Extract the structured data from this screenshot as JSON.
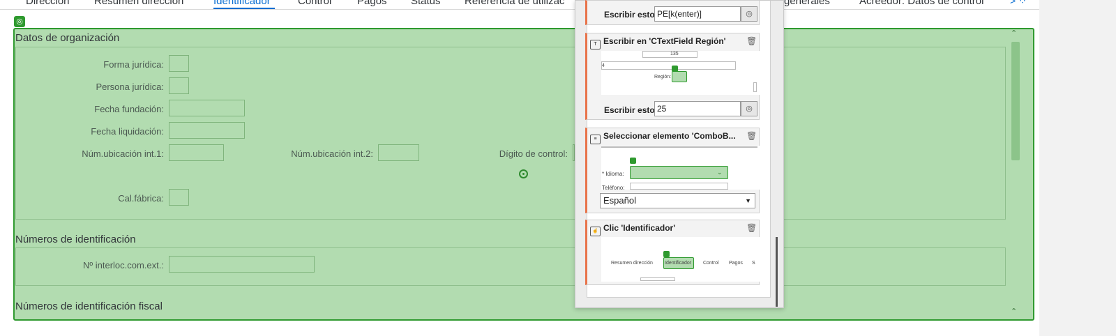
{
  "tabs": [
    {
      "label": "Dirección",
      "active": false
    },
    {
      "label": "Resumen dirección",
      "active": false
    },
    {
      "label": "Identificador",
      "active": true
    },
    {
      "label": "Control",
      "active": false
    },
    {
      "label": "Pagos",
      "active": false
    },
    {
      "label": "Status",
      "active": false
    },
    {
      "label": "Referencia de utilizac",
      "active": false
    },
    {
      "label": "generales",
      "active": false
    },
    {
      "label": "Acreedor: Datos de control",
      "active": false
    }
  ],
  "tabs_more": "> ⁘",
  "form": {
    "section_org": "Datos de organización",
    "forma_juridica": "Forma jurídica:",
    "persona_juridica": "Persona jurídica:",
    "fecha_fundacion": "Fecha fundación:",
    "fecha_liquidacion": "Fecha liquidación:",
    "num_ubicacion_1": "Núm.ubicación int.1:",
    "num_ubicacion_2": "Núm.ubicación int.2:",
    "digito_control": "Dígito de control:",
    "cal_fabrica": "Cal.fábrica:",
    "section_ids": "Números de identificación",
    "interloc": "Nº interloc.com.ext.:",
    "section_fiscal": "Números de identificación fiscal"
  },
  "panel": {
    "card1": {
      "write_label": "Escribir esto",
      "write_value": "PE[k(enter)]"
    },
    "card2": {
      "title": "Escribir en 'CTextField Región'",
      "thumb_value": "135",
      "thumb_first": "4",
      "thumb_label": "Región:",
      "write_label": "Escribir esto",
      "write_value": "25"
    },
    "card3": {
      "title": "Seleccionar elemento 'ComboB...",
      "thumb_label": "* Idioma:",
      "thumb_label2": "Teléfono:",
      "select_value": "Español"
    },
    "card4": {
      "title": "Clic 'Identificador'",
      "thumb_tabs": [
        "Resumen dirección",
        "Identificador",
        "Control",
        "Pagos",
        "S"
      ]
    }
  }
}
